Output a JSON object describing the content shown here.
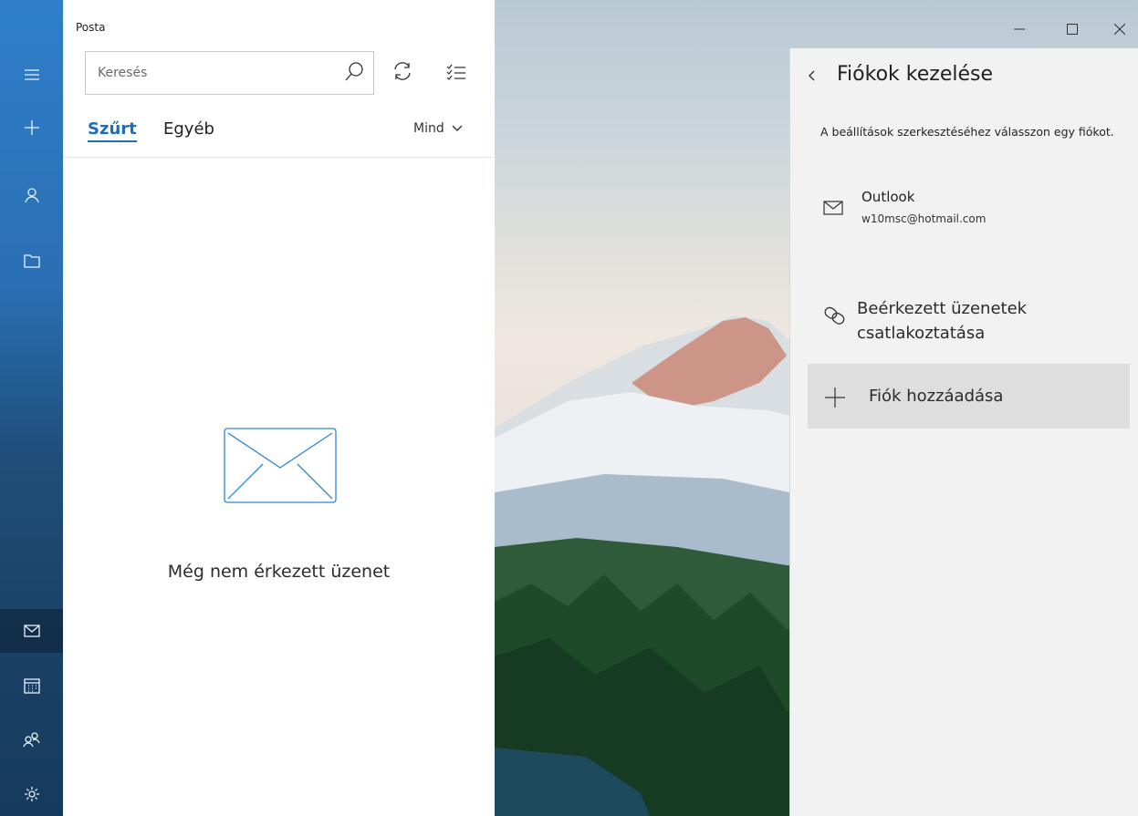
{
  "app": {
    "title": "Posta"
  },
  "rail": {
    "items": [
      {
        "name": "menu",
        "icon": "hamburger-icon"
      },
      {
        "name": "new-mail",
        "icon": "plus-icon"
      },
      {
        "name": "accounts",
        "icon": "person-icon"
      },
      {
        "name": "folders",
        "icon": "folder-icon"
      },
      {
        "name": "mail",
        "icon": "mail-icon",
        "active": true
      },
      {
        "name": "calendar",
        "icon": "calendar-icon"
      },
      {
        "name": "people",
        "icon": "people-icon"
      },
      {
        "name": "settings",
        "icon": "gear-icon"
      }
    ]
  },
  "list": {
    "search_placeholder": "Keresés",
    "tabs": {
      "filtered": "Szűrt",
      "other": "Egyéb"
    },
    "filter_label": "Mind",
    "empty_message": "Még nem érkezett üzenet"
  },
  "flyout": {
    "title": "Fiókok kezelése",
    "description": "A beállítások szerkesztéséhez válasszon egy fiókot.",
    "account": {
      "name": "Outlook",
      "email": "w10msc@hotmail.com"
    },
    "link_inboxes": "Beérkezett üzenetek csatlakoztatása",
    "add_account": "Fiók hozzáadása"
  },
  "colors": {
    "accent": "#1e6db7",
    "rail": "#2a6fb4",
    "flyout_bg": "#f2f2f2"
  }
}
